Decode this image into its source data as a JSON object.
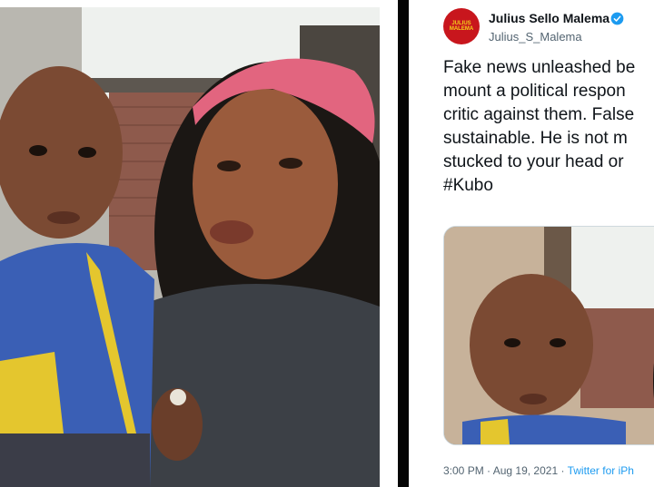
{
  "tweet": {
    "author_name": "Julius Sello Malema",
    "handle": "Julius_S_Malema",
    "verified": true,
    "avatar_text": "JULIUS MALEMA",
    "text_lines": [
      "Fake news unleashed be",
      "mount a political respon",
      "critic against them. False",
      "sustainable. He is not m",
      "stucked to your head or",
      "#Kubo"
    ],
    "time": "3:00 PM",
    "separator": "·",
    "date": "Aug 19, 2021",
    "source": "Twitter for iPh"
  },
  "colors": {
    "verified_blue": "#1d9bf0",
    "link_blue": "#1d9bf0",
    "avatar_red": "#c8161d",
    "headscarf_pink": "#e2657f",
    "jacket_blue": "#3a5fb5",
    "jacket_yellow": "#e4c62e"
  }
}
